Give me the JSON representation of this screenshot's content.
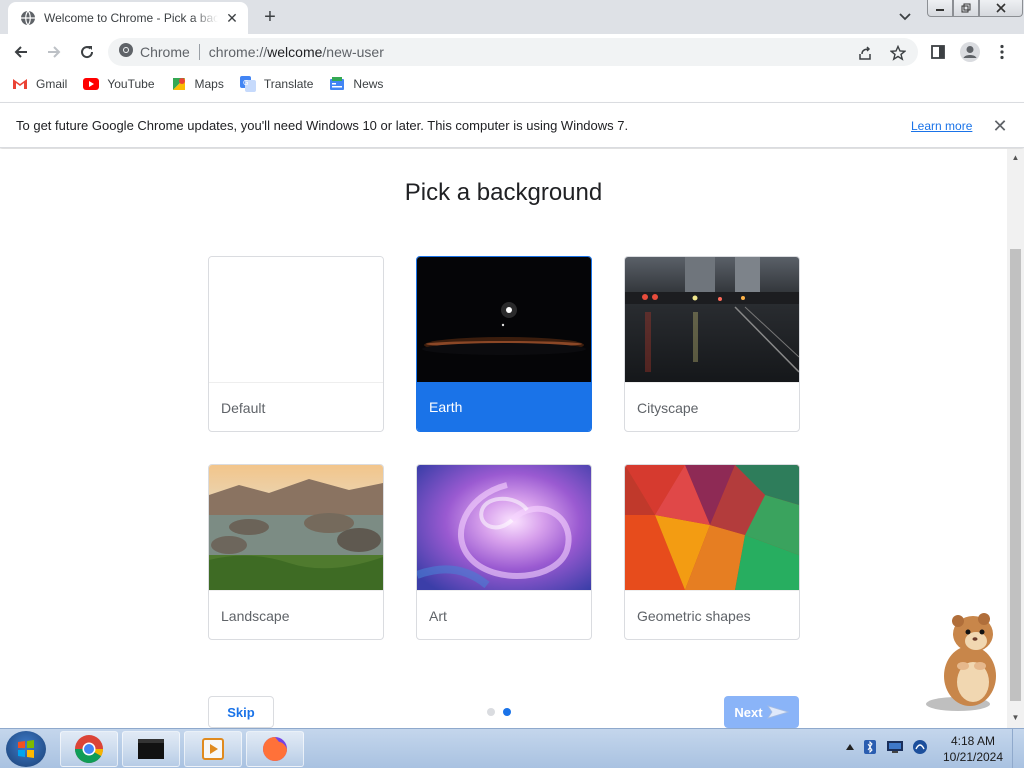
{
  "browser": {
    "tab_title": "Welcome to Chrome - Pick a background",
    "new_tab_symbol": "+",
    "omnibox": {
      "site_chip": "Chrome",
      "url_prefix": "chrome://",
      "url_host": "welcome",
      "url_path": "/new-user"
    }
  },
  "bookmarks": [
    {
      "label": "Gmail",
      "icon": "gmail-icon"
    },
    {
      "label": "YouTube",
      "icon": "youtube-icon"
    },
    {
      "label": "Maps",
      "icon": "maps-icon"
    },
    {
      "label": "Translate",
      "icon": "translate-icon"
    },
    {
      "label": "News",
      "icon": "news-icon"
    }
  ],
  "infobar": {
    "message": "To get future Google Chrome updates, you'll need Windows 10 or later. This computer is using Windows 7.",
    "link": "Learn more"
  },
  "page": {
    "title": "Pick a background",
    "backgrounds": [
      {
        "label": "Default",
        "selected": false
      },
      {
        "label": "Earth",
        "selected": true
      },
      {
        "label": "Cityscape",
        "selected": false
      },
      {
        "label": "Landscape",
        "selected": false
      },
      {
        "label": "Art",
        "selected": false
      },
      {
        "label": "Geometric shapes",
        "selected": false
      }
    ],
    "skip_label": "Skip",
    "next_label": "Next",
    "step_total": 2,
    "step_current": 2
  },
  "taskbar": {
    "apps": [
      "chrome-icon",
      "terminal-icon",
      "media-player-icon",
      "firefox-icon"
    ],
    "time": "4:18 AM",
    "date": "10/21/2024"
  },
  "colors": {
    "accent": "#1a73e8",
    "next_disabled": "#8ab4f8"
  }
}
